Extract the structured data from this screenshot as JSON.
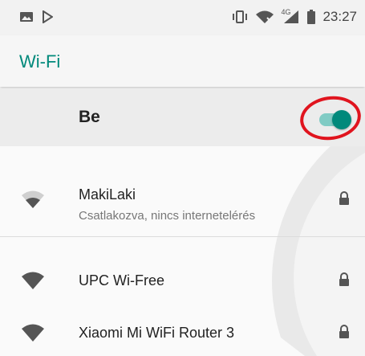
{
  "statusbar": {
    "time": "23:27",
    "network_label": "4G",
    "icons": [
      "image-icon",
      "play-store-icon",
      "vibrate-icon",
      "wifi-signal-icon",
      "cellular-signal-icon",
      "battery-icon"
    ]
  },
  "appbar": {
    "title": "Wi-Fi"
  },
  "master": {
    "label": "Be",
    "enabled": true
  },
  "networks": [
    {
      "name": "MakiLaki",
      "status": "Csatlakozva, nincs internetelérés",
      "secured": true,
      "signal": "wifi-medium-icon"
    },
    {
      "name": "UPC Wi-Free",
      "status": "",
      "secured": true,
      "signal": "wifi-full-icon"
    },
    {
      "name": "Xiaomi Mi WiFi Router 3",
      "status": "",
      "secured": true,
      "signal": "wifi-full-icon"
    }
  ],
  "colors": {
    "accent": "#00897b",
    "toggle_track": "#80cbc4",
    "highlight": "#e0141e"
  }
}
